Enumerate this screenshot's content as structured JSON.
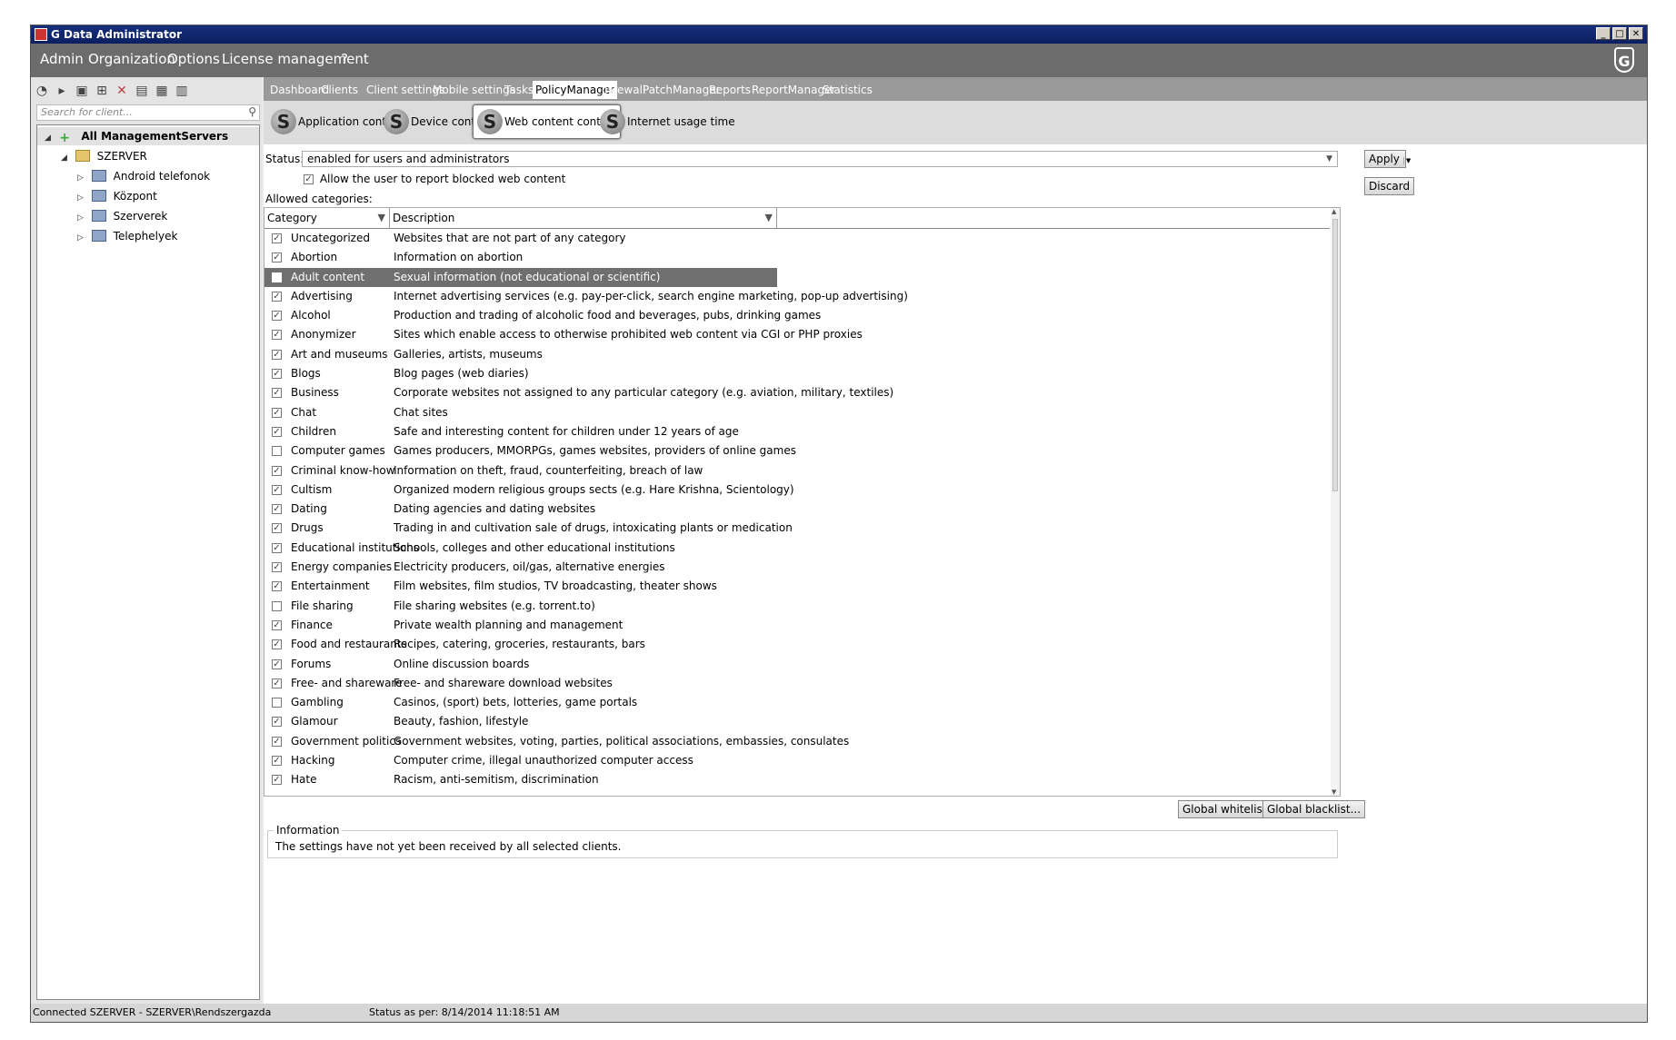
{
  "window": {
    "title": "G Data Administrator",
    "min": "_",
    "max": "□",
    "close": "✕"
  },
  "menu": [
    "Admin",
    "Organization",
    "Options",
    "License management",
    "?"
  ],
  "brand": {
    "logo": "G"
  },
  "left": {
    "search_placeholder": "Search for client...",
    "tree": {
      "root": "All ManagementServers",
      "server": "SZERVER",
      "children": [
        "Android telefonok",
        "Központ",
        "Szerverek",
        "Telephelyek"
      ]
    }
  },
  "tabs": [
    "Dashboard",
    "Clients",
    "Client settings",
    "Mobile settings",
    "Tasks",
    "PolicyManager",
    "Firewall",
    "PatchManager",
    "Reports",
    "ReportManager",
    "Statistics"
  ],
  "active_tab": "PolicyManager",
  "subtabs": [
    "Application control",
    "Device control",
    "Web content control",
    "Internet usage time"
  ],
  "active_subtab": "Web content control",
  "status": {
    "label": "Status:",
    "value": "enabled for users and administrators"
  },
  "allow_report": {
    "label": "Allow the user to report blocked web content",
    "checked": true
  },
  "allowed_label": "Allowed categories:",
  "buttons": {
    "apply": "Apply",
    "discard": "Discard",
    "whitelist": "Global whitelist...",
    "blacklist": "Global blacklist..."
  },
  "columns": {
    "category": "Category",
    "description": "Description"
  },
  "categories": [
    {
      "name": "Uncategorized",
      "desc": "Websites that are not part of any category",
      "checked": true
    },
    {
      "name": "Abortion",
      "desc": "Information on abortion",
      "checked": true
    },
    {
      "name": "Adult content",
      "desc": "Sexual information (not educational or scientific)",
      "checked": false,
      "selected": true
    },
    {
      "name": "Advertising",
      "desc": "Internet advertising services (e.g. pay-per-click, search engine marketing, pop-up advertising)",
      "checked": true
    },
    {
      "name": "Alcohol",
      "desc": "Production and trading of alcoholic food and beverages, pubs, drinking games",
      "checked": true
    },
    {
      "name": "Anonymizer",
      "desc": "Sites which enable access to otherwise prohibited web content via CGI or PHP proxies",
      "checked": true
    },
    {
      "name": "Art and museums",
      "desc": "Galleries, artists, museums",
      "checked": true
    },
    {
      "name": "Blogs",
      "desc": "Blog pages (web diaries)",
      "checked": true
    },
    {
      "name": "Business",
      "desc": "Corporate websites not assigned to any particular category (e.g. aviation, military, textiles)",
      "checked": true
    },
    {
      "name": "Chat",
      "desc": "Chat sites",
      "checked": true
    },
    {
      "name": "Children",
      "desc": "Safe and interesting content for children under 12 years of age",
      "checked": true
    },
    {
      "name": "Computer games",
      "desc": "Games producers, MMORPGs, games websites, providers of online games",
      "checked": false
    },
    {
      "name": "Criminal know-how",
      "desc": "Information on theft, fraud, counterfeiting, breach of law",
      "checked": true
    },
    {
      "name": "Cultism",
      "desc": "Organized modern religious groups  sects (e.g. Hare Krishna, Scientology)",
      "checked": true
    },
    {
      "name": "Dating",
      "desc": "Dating agencies and dating websites",
      "checked": true
    },
    {
      "name": "Drugs",
      "desc": "Trading in and cultivation  sale of drugs, intoxicating plants or medication",
      "checked": true
    },
    {
      "name": "Educational institutions",
      "desc": "Schools, colleges and other educational institutions",
      "checked": true
    },
    {
      "name": "Energy companies",
      "desc": "Electricity producers, oil/gas, alternative energies",
      "checked": true
    },
    {
      "name": "Entertainment",
      "desc": "Film websites, film studios, TV broadcasting, theater shows",
      "checked": true
    },
    {
      "name": "File sharing",
      "desc": "File sharing websites (e.g. torrent.to)",
      "checked": false
    },
    {
      "name": "Finance",
      "desc": "Private wealth planning and management",
      "checked": true
    },
    {
      "name": "Food and restaurants",
      "desc": "Recipes, catering, groceries, restaurants, bars",
      "checked": true
    },
    {
      "name": "Forums",
      "desc": "Online discussion boards",
      "checked": true
    },
    {
      "name": "Free- and shareware",
      "desc": "Free- and shareware download websites",
      "checked": true
    },
    {
      "name": "Gambling",
      "desc": "Casinos, (sport) bets, lotteries, game portals",
      "checked": false
    },
    {
      "name": "Glamour",
      "desc": "Beauty, fashion, lifestyle",
      "checked": true
    },
    {
      "name": "Government  politics",
      "desc": "Government websites, voting, parties, political associations, embassies, consulates",
      "checked": true
    },
    {
      "name": "Hacking",
      "desc": "Computer crime, illegal  unauthorized computer access",
      "checked": true
    },
    {
      "name": "Hate",
      "desc": "Racism, anti-semitism, discrimination",
      "checked": true
    }
  ],
  "info": {
    "label": "Information",
    "text": "The settings have not yet been received by all selected clients."
  },
  "statusbar": {
    "left": "Connected SZERVER - SZERVER\\Rendszergazda",
    "right": "Status as per: 8/14/2014 11:18:51 AM"
  }
}
